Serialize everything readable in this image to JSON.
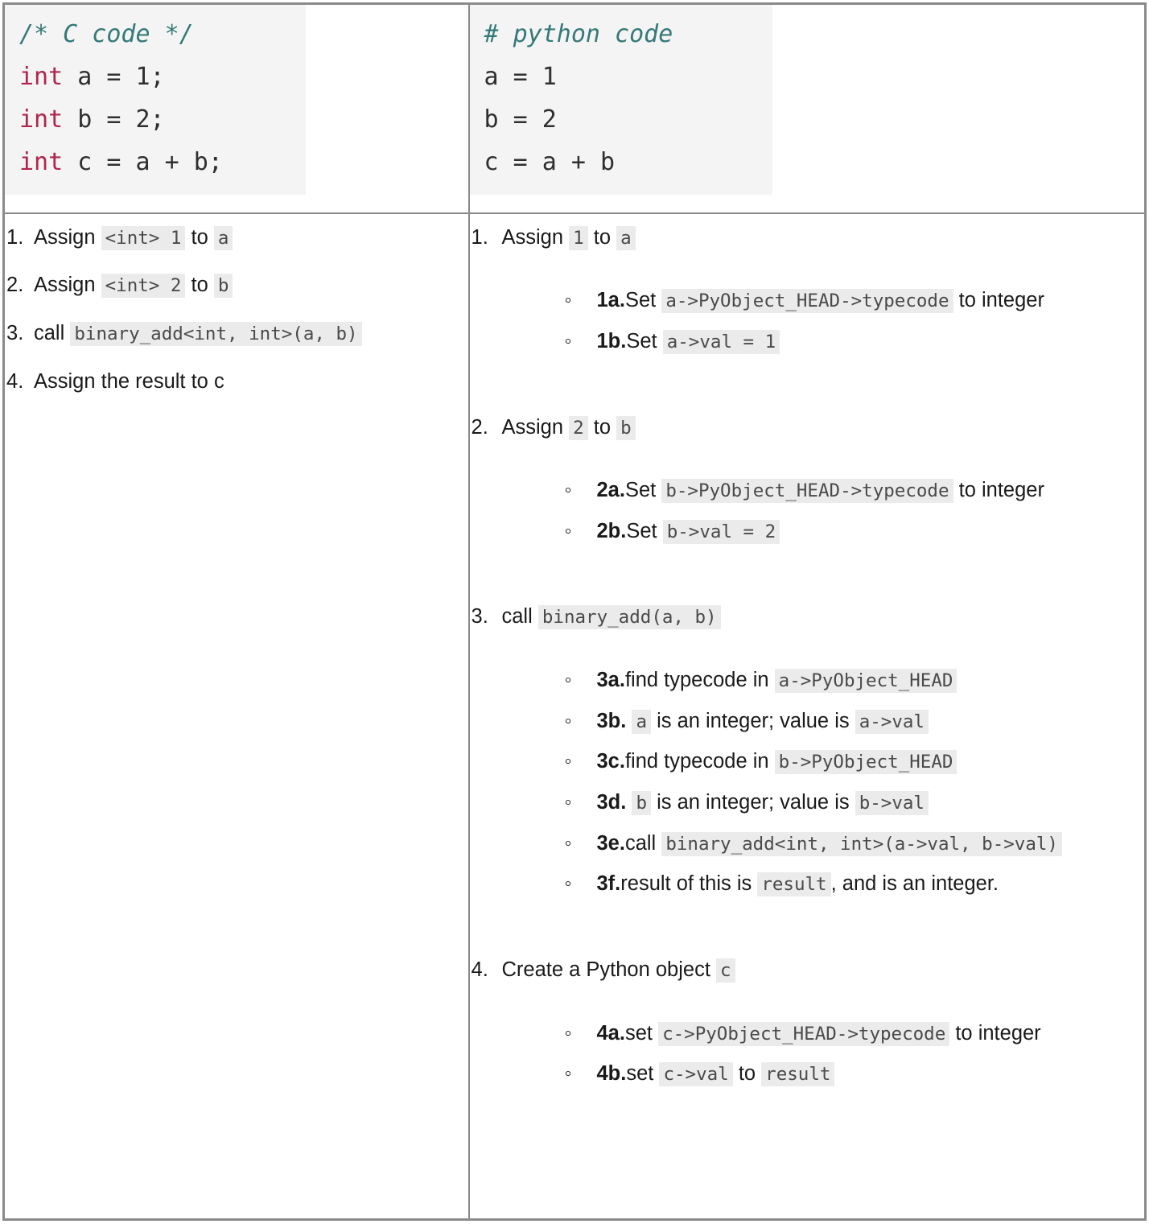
{
  "colors": {
    "border": "#8a8a8a",
    "code_bg": "#f4f4f4",
    "inline_code_bg": "#ebebeb",
    "comment": "#357a78",
    "keyword": "#b0254f",
    "text": "#1a1a1a"
  },
  "left_column": {
    "code": {
      "language": "c",
      "comment": "/* C code */",
      "lines": [
        {
          "keyword": "int",
          "rest": " a = 1;"
        },
        {
          "keyword": "int",
          "rest": " b = 2;"
        },
        {
          "keyword": "int",
          "rest": " c = a + b;"
        }
      ]
    },
    "steps": [
      {
        "number": "1.",
        "parts": [
          {
            "type": "text",
            "value": "Assign "
          },
          {
            "type": "code",
            "value": "<int> 1"
          },
          {
            "type": "text",
            "value": " to "
          },
          {
            "type": "code",
            "value": "a"
          }
        ]
      },
      {
        "number": "2.",
        "parts": [
          {
            "type": "text",
            "value": "Assign "
          },
          {
            "type": "code",
            "value": "<int> 2"
          },
          {
            "type": "text",
            "value": " to "
          },
          {
            "type": "code",
            "value": "b"
          }
        ]
      },
      {
        "number": "3.",
        "parts": [
          {
            "type": "text",
            "value": "call "
          },
          {
            "type": "code",
            "value": "binary_add<int, int>(a, b)"
          }
        ]
      },
      {
        "number": "4.",
        "parts": [
          {
            "type": "text",
            "value": "Assign the result to c"
          }
        ]
      }
    ]
  },
  "right_column": {
    "code": {
      "language": "python",
      "comment": "# python code",
      "lines": [
        {
          "keyword": "",
          "rest": "a = 1"
        },
        {
          "keyword": "",
          "rest": "b = 2"
        },
        {
          "keyword": "",
          "rest": "c = a + b"
        }
      ]
    },
    "steps": [
      {
        "number": "1.",
        "text_before": "Assign ",
        "code_1": "1",
        "text_mid": " to ",
        "code_2": "a",
        "substeps": [
          {
            "label": "1a.",
            "text_before": "Set ",
            "code": "a->PyObject_HEAD->typecode",
            "text_after": " to integer"
          },
          {
            "label": "1b.",
            "text_before": "Set ",
            "code": "a->val = 1",
            "text_after": ""
          }
        ]
      },
      {
        "number": "2.",
        "text_before": "Assign ",
        "code_1": "2",
        "text_mid": " to ",
        "code_2": "b",
        "substeps": [
          {
            "label": "2a.",
            "text_before": "Set ",
            "code": "b->PyObject_HEAD->typecode",
            "text_after": " to integer"
          },
          {
            "label": "2b.",
            "text_before": "Set ",
            "code": "b->val = 2",
            "text_after": ""
          }
        ]
      },
      {
        "number": "3.",
        "text_before": "call ",
        "code_1": "binary_add(a, b)",
        "text_mid": "",
        "code_2": "",
        "substeps": [
          {
            "label": "3a.",
            "text_before": "find typecode in ",
            "code": "a->PyObject_HEAD",
            "text_after": ""
          },
          {
            "label": "3b.",
            "text_before": "",
            "code": "a",
            "text_after": " is an integer; value is ",
            "code_2": "a->val"
          },
          {
            "label": "3c.",
            "text_before": "find typecode in ",
            "code": "b->PyObject_HEAD",
            "text_after": ""
          },
          {
            "label": "3d.",
            "text_before": "",
            "code": "b",
            "text_after": " is an integer; value is ",
            "code_2": "b->val"
          },
          {
            "label": "3e.",
            "text_before": "call ",
            "code": "binary_add<int, int>(a->val, b->val)",
            "text_after": ""
          },
          {
            "label": "3f.",
            "text_before": "result of this is ",
            "code": "result",
            "text_after": ", and is an integer."
          }
        ]
      },
      {
        "number": "4.",
        "text_before": "Create a Python object ",
        "code_1": "c",
        "text_mid": "",
        "code_2": "",
        "substeps": [
          {
            "label": "4a.",
            "text_before": "set ",
            "code": "c->PyObject_HEAD->typecode",
            "text_after": " to integer"
          },
          {
            "label": "4b.",
            "text_before": "set ",
            "code": "c->val",
            "text_after": " to ",
            "code_2": "result"
          }
        ]
      }
    ]
  }
}
